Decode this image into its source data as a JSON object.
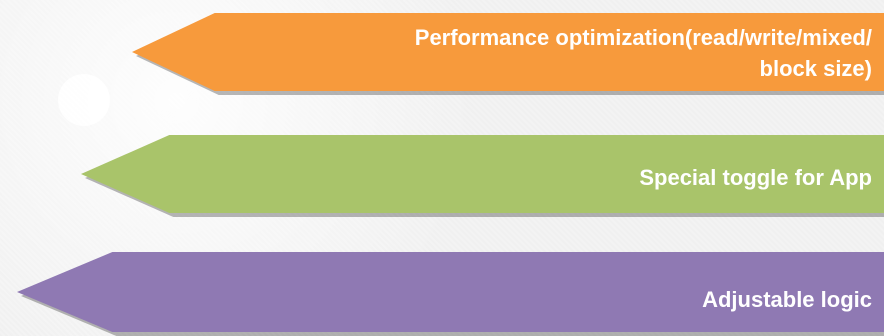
{
  "arrows": [
    {
      "lines": [
        "Performance optimization(read/write/mixed/",
        "block size)"
      ],
      "color": "#f79a3c"
    },
    {
      "lines": [
        "Special toggle for App"
      ],
      "color": "#a9c46a"
    },
    {
      "lines": [
        "Adjustable logic"
      ],
      "color": "#8f79b3"
    }
  ]
}
